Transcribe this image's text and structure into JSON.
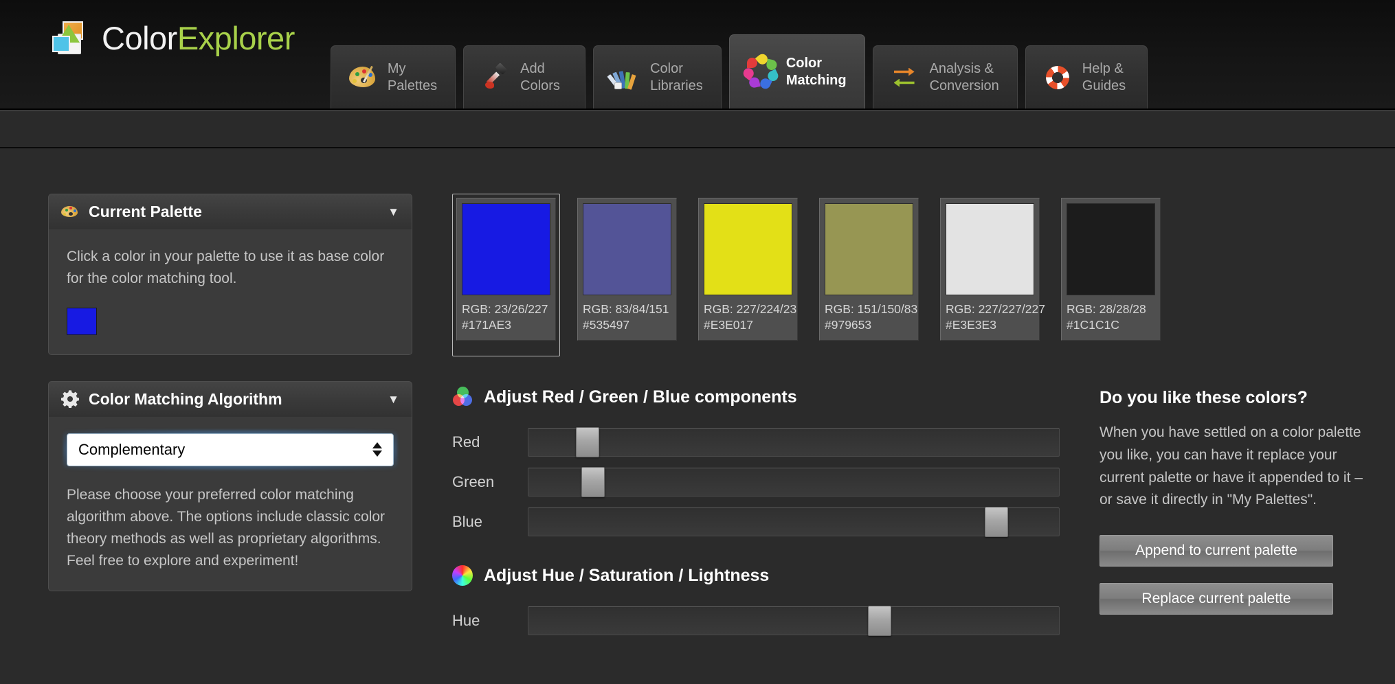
{
  "brand": {
    "name_part1": "Color",
    "name_part2": "Explorer",
    "logo_icon": "color-explorer-logo-icon"
  },
  "nav": {
    "tabs": [
      {
        "label": "My\nPalettes",
        "icon": "palette-icon",
        "active": false
      },
      {
        "label": "Add\nColors",
        "icon": "eyedropper-icon",
        "active": false
      },
      {
        "label": "Color\nLibraries",
        "icon": "color-fan-icon",
        "active": false
      },
      {
        "label": "Color\nMatching",
        "icon": "color-flower-icon",
        "active": true
      },
      {
        "label": "Analysis &\nConversion",
        "icon": "swap-arrows-icon",
        "active": false
      },
      {
        "label": "Help &\nGuides",
        "icon": "lifebuoy-icon",
        "active": false
      }
    ]
  },
  "sidebar": {
    "current_palette": {
      "title": "Current Palette",
      "icon": "palette-icon",
      "caret": "▼",
      "description": "Click a color in your palette to use it as base color for the color matching tool.",
      "base_color": "#171ae3"
    },
    "algorithm": {
      "title": "Color Matching Algorithm",
      "icon": "gear-icon",
      "caret": "▼",
      "selected": "Complementary",
      "description": "Please choose your preferred color matching algorithm above. The options include classic color theory methods as well as proprietary algorithms. Feel free to explore and experiment!"
    }
  },
  "swatches": [
    {
      "hex": "#171AE3",
      "rgb_label": "RGB: 23/26/227",
      "hex_label": "#171AE3",
      "selected": true
    },
    {
      "hex": "#535497",
      "rgb_label": "RGB: 83/84/151",
      "hex_label": "#535497",
      "selected": false
    },
    {
      "hex": "#E3E017",
      "rgb_label": "RGB: 227/224/23",
      "hex_label": "#E3E017",
      "selected": false
    },
    {
      "hex": "#979653",
      "rgb_label": "RGB: 151/150/83",
      "hex_label": "#979653",
      "selected": false
    },
    {
      "hex": "#E3E3E3",
      "rgb_label": "RGB: 227/227/227",
      "hex_label": "#E3E3E3",
      "selected": false
    },
    {
      "hex": "#1C1C1C",
      "rgb_label": "RGB: 28/28/28",
      "hex_label": "#1C1C1C",
      "selected": false
    }
  ],
  "rgb_section": {
    "title": "Adjust Red / Green / Blue components",
    "icon": "rgb-circles-icon",
    "sliders": [
      {
        "label": "Red",
        "percent": 9
      },
      {
        "label": "Green",
        "percent": 10
      },
      {
        "label": "Blue",
        "percent": 86
      }
    ]
  },
  "hsl_section": {
    "title": "Adjust Hue / Saturation / Lightness",
    "icon": "hue-wheel-icon",
    "sliders": [
      {
        "label": "Hue",
        "percent": 64
      }
    ]
  },
  "right_panel": {
    "heading": "Do you like these colors?",
    "body": "When you have settled on a color palette you like, you can have it replace your current palette or have it appended to it – or save it directly in \"My Palettes\".",
    "append_button": "Append to current palette",
    "replace_button": "Replace current palette"
  }
}
